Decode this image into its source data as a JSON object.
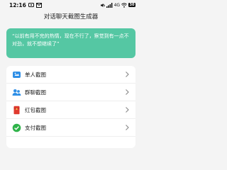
{
  "status_bar": {
    "time": "12:16",
    "network": "4G",
    "battery": "30"
  },
  "header": {
    "title": "对话聊天截图生成器"
  },
  "banner": {
    "quote": "“以前有用不完的热情，现在不行了，察觉到有一点不对劲，就不想继续了”"
  },
  "menu": {
    "items": [
      {
        "label": "单人截图",
        "icon": "single-chat-icon"
      },
      {
        "label": "群聊截图",
        "icon": "group-chat-icon"
      },
      {
        "label": "红包截图",
        "icon": "red-packet-icon"
      },
      {
        "label": "支付截图",
        "icon": "payment-check-icon"
      }
    ]
  },
  "colors": {
    "accent_green": "#55c7a3",
    "icon_blue": "#2f8fe6",
    "red_packet": "#e03a2f",
    "pay_green": "#2fb34a"
  }
}
